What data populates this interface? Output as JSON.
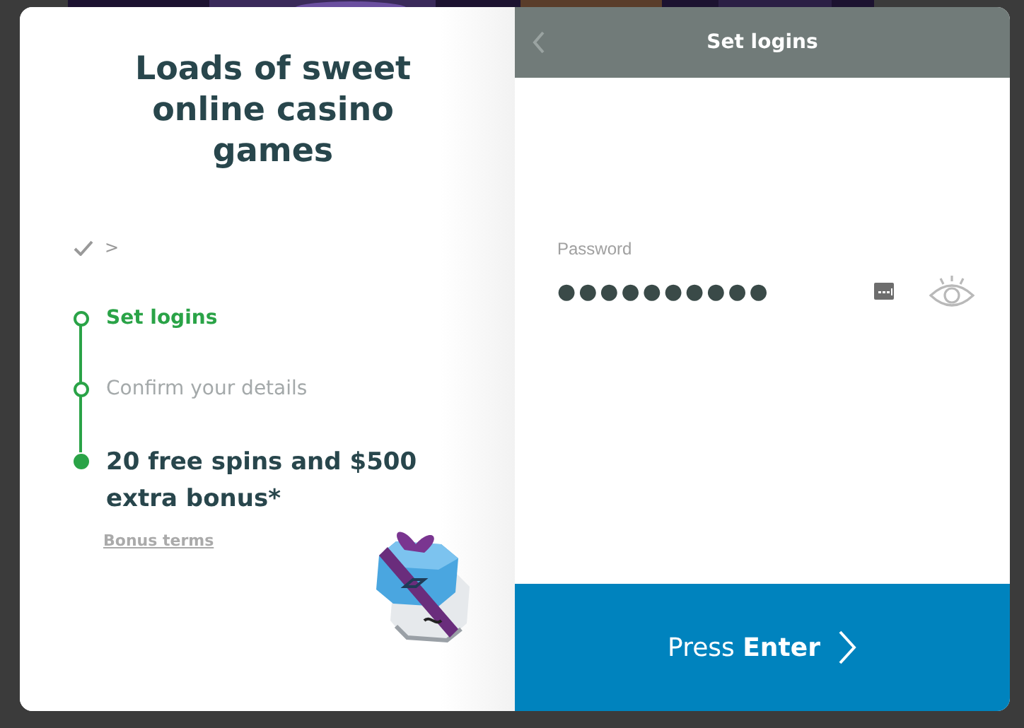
{
  "header": {
    "title": "Loads of sweet online casino games"
  },
  "progress": {
    "done_marker": ">",
    "steps": [
      {
        "label": "Set logins",
        "selected": true
      },
      {
        "label": "Confirm your details",
        "selected": false
      }
    ],
    "reward": {
      "label": "20 free spins and $500 extra bonus*",
      "link": "Bonus terms"
    }
  },
  "form": {
    "title": "Set logins",
    "password": {
      "label": "Password",
      "value": "●●●●●●●●●●",
      "revealed": false
    },
    "submit": "Press **Enter**"
  }
}
